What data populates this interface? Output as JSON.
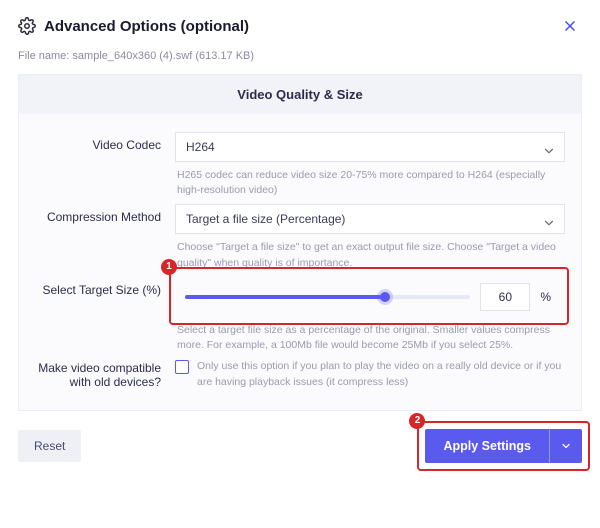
{
  "header": {
    "title": "Advanced Options (optional)"
  },
  "file": {
    "label": "File name:",
    "name": "sample_640x360 (4).swf",
    "size": "(613.17 KB)"
  },
  "panel": {
    "title": "Video Quality & Size"
  },
  "codec": {
    "label": "Video Codec",
    "value": "H264",
    "hint": "H265 codec can reduce video size 20-75% more compared to H264 (especially high-resolution video)"
  },
  "compression": {
    "label": "Compression Method",
    "value": "Target a file size (Percentage)",
    "hint": "Choose \"Target a file size\" to get an exact output file size. Choose \"Target a video quality\" when quality is of importance."
  },
  "target": {
    "label": "Select Target Size (%)",
    "value": "60",
    "percent_sign": "%",
    "slider_fill_pct": 70,
    "hint": "Select a target file size as a percentage of the original. Smaller values compress more. For example, a 100Mb file would become 25Mb if you select 25%."
  },
  "compat": {
    "label": "Make video compatible with old devices?",
    "hint": "Only use this option if you plan to play the video on a really old device or if you are having playback issues (it compress less)"
  },
  "footer": {
    "reset": "Reset",
    "apply": "Apply Settings"
  },
  "annotations": {
    "one": "1",
    "two": "2"
  }
}
